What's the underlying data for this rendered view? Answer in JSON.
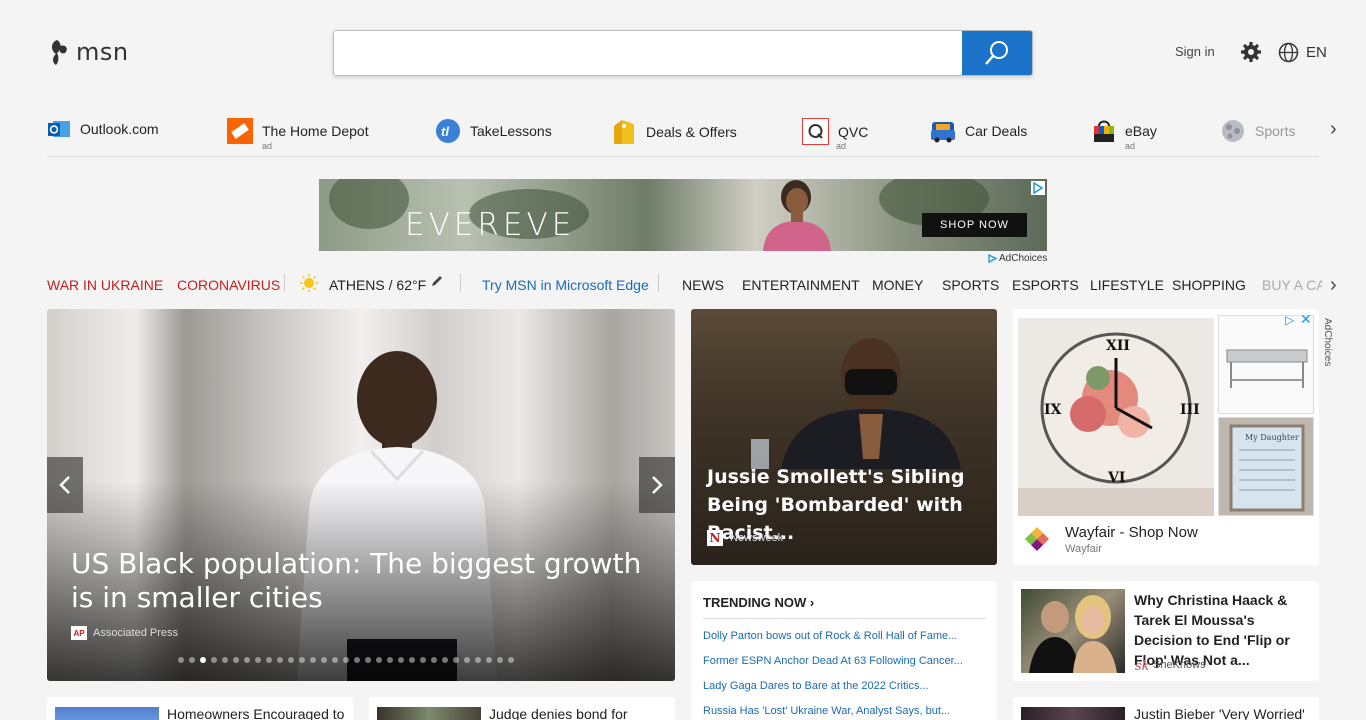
{
  "header": {
    "logo_text": "msn",
    "search_placeholder": "",
    "sign_in": "Sign in",
    "language": "EN"
  },
  "quicklinks": [
    {
      "label": "Outlook.com",
      "ad": ""
    },
    {
      "label": "The Home Depot",
      "ad": "ad"
    },
    {
      "label": "TakeLessons",
      "ad": ""
    },
    {
      "label": "Deals & Offers",
      "ad": ""
    },
    {
      "label": "QVC",
      "ad": "ad"
    },
    {
      "label": "Car Deals",
      "ad": ""
    },
    {
      "label": "eBay",
      "ad": "ad"
    },
    {
      "label": "Sports",
      "ad": ""
    }
  ],
  "banner": {
    "brand": "EVEREVE",
    "cta": "SHOP NOW",
    "adchoices": "AdChoices"
  },
  "nav": {
    "topic1": "WAR IN UKRAINE",
    "topic2": "CORONAVIRUS",
    "weather": "ATHENS / 62°F",
    "edge_promo": "Try MSN in Microsoft Edge",
    "tabs": [
      "NEWS",
      "ENTERTAINMENT",
      "MONEY",
      "SPORTS",
      "ESPORTS",
      "LIFESTYLE",
      "SHOPPING",
      "BUY A CA"
    ]
  },
  "hero": {
    "title": "US Black population: The biggest growth is in smaller cities",
    "source": "Associated Press",
    "source_logo": "AP",
    "slide_count": 31,
    "active_slide": 3
  },
  "story2": {
    "title": "Jussie Smollett's Sibling Being 'Bombarded' with Racist...",
    "source": "Newsweek",
    "source_logo": "N"
  },
  "adcard": {
    "brand": "Wayfair - Shop Now",
    "sub": "Wayfair",
    "adchoices": "AdChoices",
    "sign_text": "My Daughter"
  },
  "trending": {
    "heading": "TRENDING NOW",
    "items": [
      "Dolly Parton bows out of Rock & Roll Hall of Fame...",
      "Former ESPN Anchor Dead At 63 Following Cancer...",
      "Lady Gaga Dares to Bare at the 2022 Critics...",
      "Russia Has 'Lost' Ukraine War, Analyst Says, but..."
    ]
  },
  "news3": {
    "title": "Why Christina Haack & Tarek El Moussa's Decision to End 'Flip or Flop' Was Not a...",
    "source": "SheKnows"
  },
  "bottom": {
    "card1": "Homeowners Encouraged to",
    "card2": "Judge denies bond for",
    "card3": "Justin Bieber 'Very Worried'"
  },
  "colors": {
    "accent": "#1a73c9",
    "topic_red": "#c41e1e",
    "link_blue": "#1a6bb5"
  }
}
